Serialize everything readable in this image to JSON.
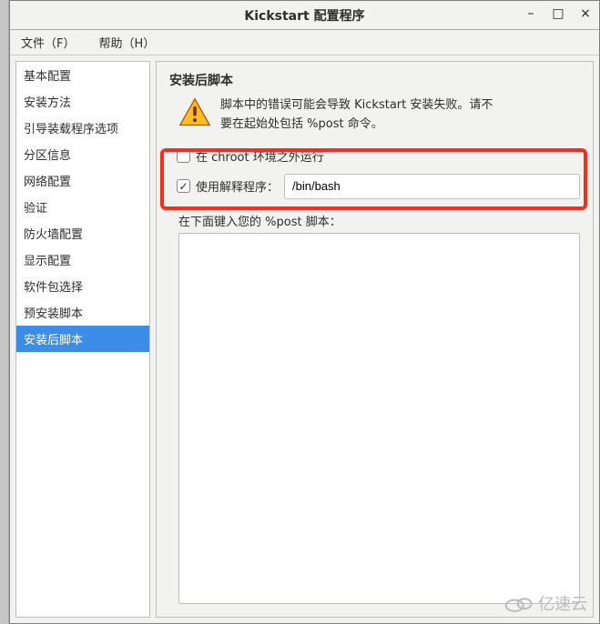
{
  "window": {
    "title": "Kickstart 配置程序"
  },
  "menu": {
    "file": "文件（F）",
    "help": "帮助（H）"
  },
  "sidebar": {
    "items": [
      "基本配置",
      "安装方法",
      "引导装载程序选项",
      "分区信息",
      "网络配置",
      "验证",
      "防火墙配置",
      "显示配置",
      "软件包选择",
      "预安装脚本",
      "安装后脚本"
    ],
    "selected_index": 10
  },
  "main": {
    "section_title": "安装后脚本",
    "warning_line1": "脚本中的错误可能会导致  Kickstart  安装失败。请不",
    "warning_line2": "要在起始处包括  %post 命令。",
    "chroot_label": "在  chroot  环境之外运行",
    "chroot_checked": false,
    "interpreter_label": "使用解释程序：",
    "interpreter_checked": true,
    "interpreter_value": "/bin/bash",
    "prompt_label": "在下面键入您的  %post 脚本："
  },
  "watermark": {
    "text": "亿速云"
  }
}
